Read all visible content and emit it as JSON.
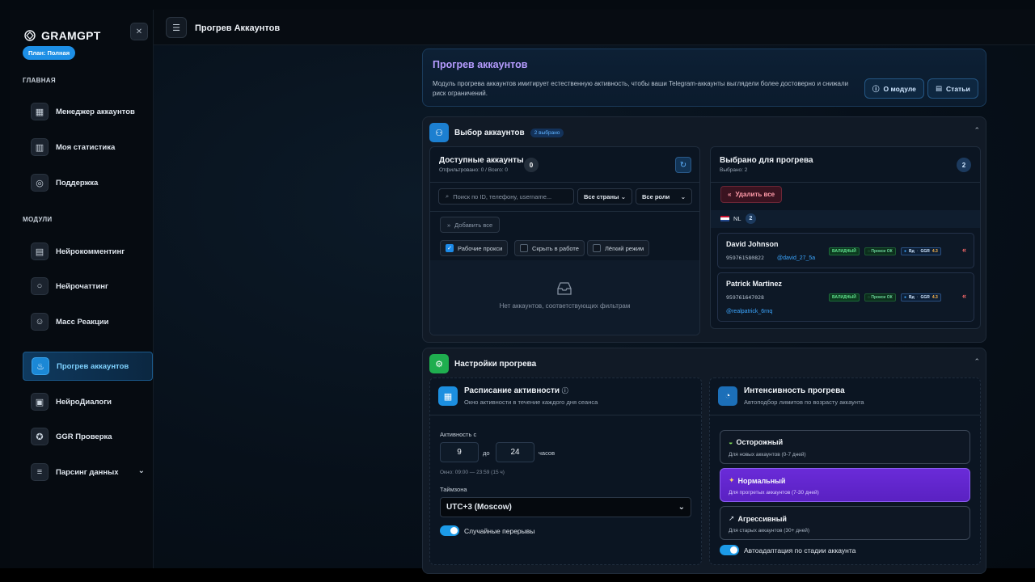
{
  "sidebar": {
    "brand": "GRAMGPT",
    "plan": "План: Полная",
    "section_main": "ГЛАВНАЯ",
    "section_modules": "МОДУЛИ",
    "items": [
      {
        "label": "Менеджер аккаунтов",
        "icon": "grid-icon"
      },
      {
        "label": "Моя статистика",
        "icon": "chart-icon"
      },
      {
        "label": "Поддержка",
        "icon": "lifebuoy-icon"
      },
      {
        "label": "Нейрокомментинг",
        "icon": "comment-icon"
      },
      {
        "label": "Нейрочаттинг",
        "icon": "chat-bubble-icon"
      },
      {
        "label": "Масс Реакции",
        "icon": "smile-icon"
      },
      {
        "label": "Прогрев аккаунтов",
        "icon": "flame-icon"
      },
      {
        "label": "НейроДиалоги",
        "icon": "dialogs-icon"
      },
      {
        "label": "GGR Проверка",
        "icon": "star-icon"
      },
      {
        "label": "Парсинг данных",
        "icon": "database-icon"
      }
    ]
  },
  "topbar": {
    "title": "Прогрев Аккаунтов"
  },
  "hero": {
    "title": "Прогрев аккаунтов",
    "description": "Модуль прогрева аккаунтов имитирует естественную активность, чтобы ваши Telegram-аккаунты выглядели более достоверно и снижали риск ограничений.",
    "about_button": "О модуле",
    "articles_button": "Статьи"
  },
  "selection": {
    "title": "Выбор аккаунтов",
    "badge": "2 выбрано",
    "available": {
      "title": "Доступные аккаунты",
      "subtitle": "Отфильтровано: 0 / Всего: 0",
      "count": "0",
      "search_placeholder": "Поиск по ID, телефону, username...",
      "country_select": "Все страны",
      "role_select": "Все роли",
      "add_all": "Добавить все",
      "filters": [
        {
          "label": "Рабочие прокси",
          "checked": true
        },
        {
          "label": "Скрыть в работе",
          "checked": false
        },
        {
          "label": "Лёгкий режим",
          "checked": false
        }
      ],
      "empty": "Нет аккаунтов, соответствующих фильтрам"
    },
    "selected": {
      "title": "Выбрано для прогрева",
      "subtitle": "Выбрано: 2",
      "count": "2",
      "delete_all": "Удалить все",
      "country": "NL",
      "country_count": "2",
      "accounts": [
        {
          "name": "David Johnson",
          "phone": "959761580822",
          "username": "@david_27_5a",
          "status": "ВАЛИДНЫЙ",
          "proxy": "Прокси ОК",
          "vd": "Вд",
          "ggr_label": "GGR",
          "ggr": "4.3"
        },
        {
          "name": "Patrick Martinez",
          "phone": "959761647028",
          "username": "@realpatrick_6rnq",
          "status": "ВАЛИДНЫЙ",
          "proxy": "Прокси ОК",
          "vd": "Вд",
          "ggr_label": "GGR",
          "ggr": "4.3"
        }
      ]
    }
  },
  "settings": {
    "title": "Настройки прогрева",
    "schedule": {
      "title": "Расписание активности",
      "subtitle": "Окно активности в течение каждого дня сеанса",
      "activity_from_label": "Активность с",
      "from": "9",
      "to_label": "до",
      "to": "24",
      "hours_label": "часов",
      "window_note": "Окно: 09:00 — 23:59 (15 ч)",
      "timezone_label": "Таймзона",
      "timezone": "UTC+3 (Moscow)",
      "random_breaks": "Случайные перерывы"
    },
    "intensity": {
      "title": "Интенсивность прогрева",
      "subtitle": "Автоподбор лимитов по возрасту аккаунта",
      "options": [
        {
          "title": "Осторожный",
          "subtitle": "Для новых аккаунтов (0-7 дней)",
          "icon": "snail-icon",
          "selected": false
        },
        {
          "title": "Нормальный",
          "subtitle": "Для прогретых аккаунтов (7-30 дней)",
          "icon": "runner-icon",
          "selected": true
        },
        {
          "title": "Агрессивный",
          "subtitle": "Для старых аккаунтов (30+ дней)",
          "icon": "rocket-icon",
          "selected": false
        }
      ],
      "auto_adapt": "Автоадаптация по стадии аккаунта"
    }
  },
  "colors": {
    "accent": "#1d8fe6",
    "purple": "#6a2bd8",
    "danger": "#ff6b6b",
    "success": "#5fe08e"
  }
}
